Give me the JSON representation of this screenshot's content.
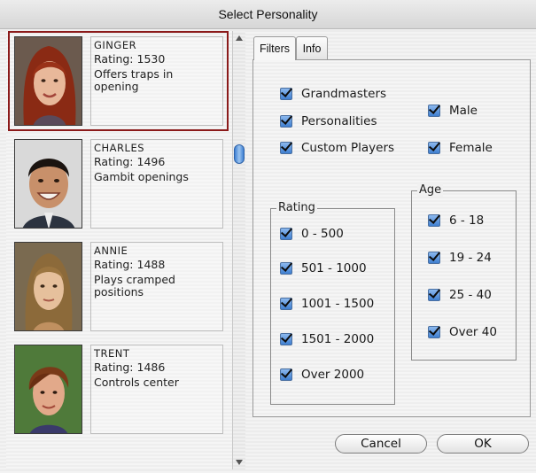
{
  "window": {
    "title": "Select Personality"
  },
  "players": [
    {
      "name": "GINGER",
      "rating": "Rating: 1530",
      "description": "Offers traps in opening",
      "selected": true
    },
    {
      "name": "CHARLES",
      "rating": "Rating: 1496",
      "description": "Gambit openings",
      "selected": false
    },
    {
      "name": "ANNIE",
      "rating": "Rating: 1488",
      "description": "Plays cramped positions",
      "selected": false
    },
    {
      "name": "TRENT",
      "rating": "Rating: 1486",
      "description": "Controls center",
      "selected": false
    }
  ],
  "tabs": [
    {
      "label": "Filters",
      "active": true
    },
    {
      "label": "Info",
      "active": false
    }
  ],
  "filters": {
    "type_options": [
      {
        "label": "Grandmasters",
        "checked": true
      },
      {
        "label": "Personalities",
        "checked": true
      },
      {
        "label": "Custom Players",
        "checked": true
      }
    ],
    "gender_options": [
      {
        "label": "Male",
        "checked": true
      },
      {
        "label": "Female",
        "checked": true
      }
    ],
    "rating": {
      "label": "Rating",
      "options": [
        {
          "label": "0 - 500",
          "checked": true
        },
        {
          "label": "501 - 1000",
          "checked": true
        },
        {
          "label": "1001 - 1500",
          "checked": true
        },
        {
          "label": "1501 - 2000",
          "checked": true
        },
        {
          "label": "Over 2000",
          "checked": true
        }
      ]
    },
    "age": {
      "label": "Age",
      "options": [
        {
          "label": "6 - 18",
          "checked": true
        },
        {
          "label": "19 - 24",
          "checked": true
        },
        {
          "label": "25 - 40",
          "checked": true
        },
        {
          "label": "Over 40",
          "checked": true
        }
      ]
    }
  },
  "buttons": {
    "cancel": "Cancel",
    "ok": "OK"
  },
  "colors": {
    "selection_border": "#8b1a1a",
    "checkbox_blue": "#3f7fd0",
    "scroll_thumb": "#3d7fd3"
  }
}
